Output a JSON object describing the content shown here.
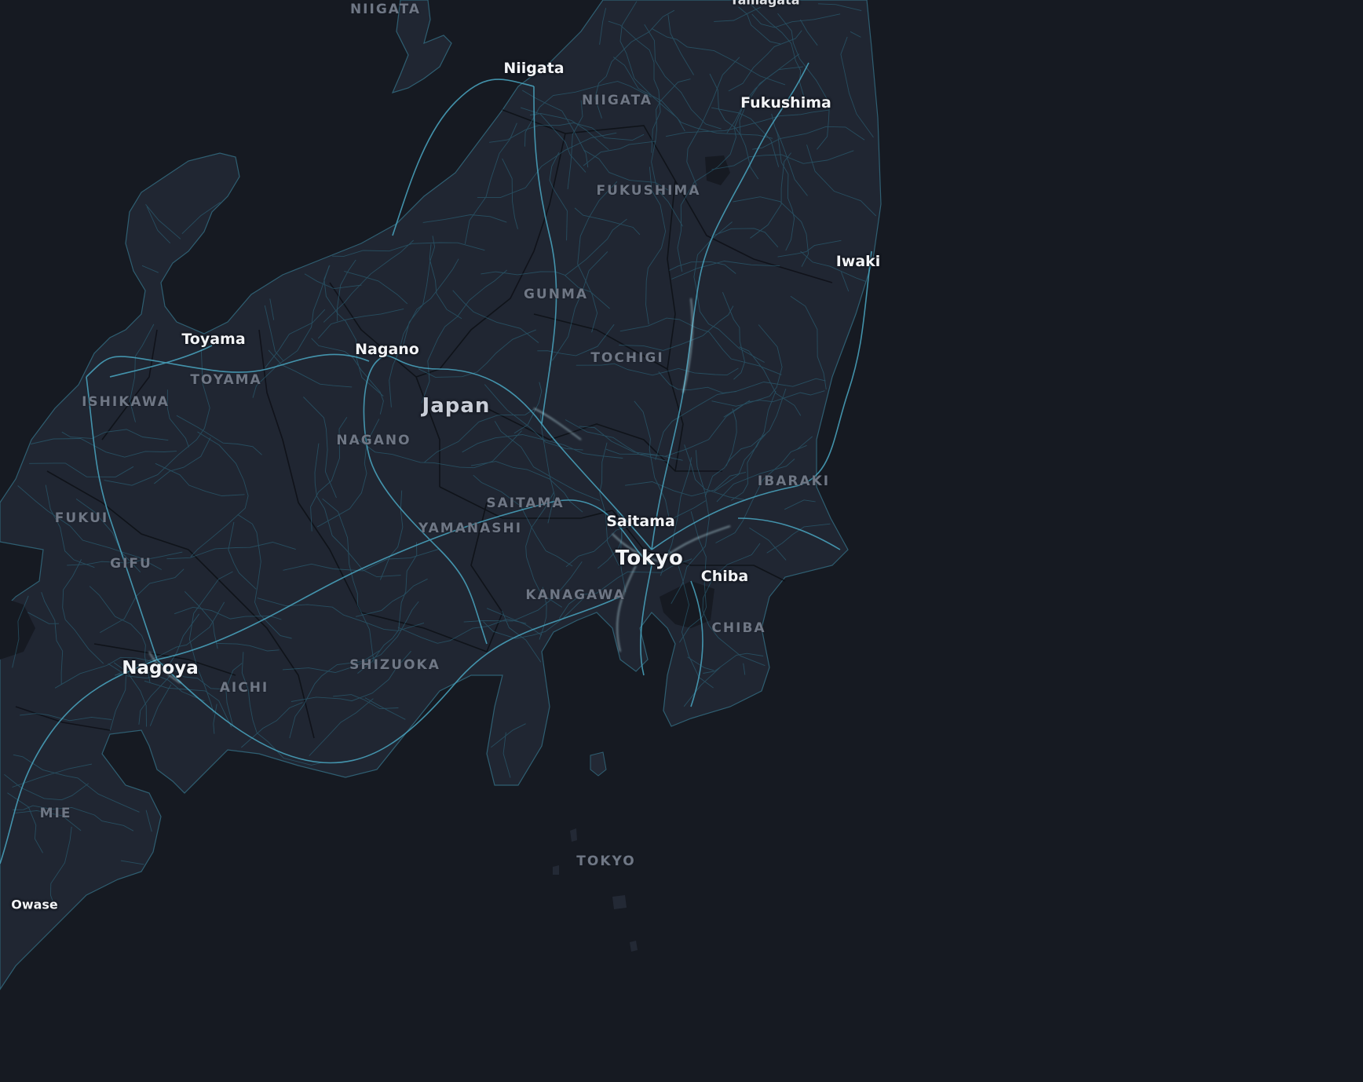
{
  "map": {
    "colors": {
      "sea": "#161a22",
      "land": "#202632",
      "borders": "#0e1117",
      "roads": "#3f96b0",
      "roads_bright": "#c8eef7",
      "city_text": "#f2f4f7",
      "pref_text": "#6f7785"
    },
    "country": "Japan",
    "cities": {
      "niigata": "Niigata",
      "fukushima": "Fukushima",
      "iwaki": "Iwaki",
      "toyama": "Toyama",
      "nagano": "Nagano",
      "saitama": "Saitama",
      "tokyo": "Tokyo",
      "chiba": "Chiba",
      "nagoya": "Nagoya",
      "owase": "Owase",
      "yamagata_partial": "Yamagata"
    },
    "prefectures": {
      "niigata_top": "NIIGATA",
      "niigata": "NIIGATA",
      "fukushima": "FUKUSHIMA",
      "gunma": "GUNMA",
      "tochigi": "TOCHIGI",
      "toyama": "TOYAMA",
      "ishikawa": "ISHIKAWA",
      "nagano": "NAGANO",
      "ibaraki": "IBARAKI",
      "saitama": "SAITAMA",
      "yamanashi": "YAMANASHI",
      "fukui": "FUKUI",
      "gifu": "GIFU",
      "kanagawa": "KANAGAWA",
      "chiba": "CHIBA",
      "shizuoka": "SHIZUOKA",
      "aichi": "AICHI",
      "mie": "MIE",
      "tokyo_islands": "TOKYO"
    }
  }
}
